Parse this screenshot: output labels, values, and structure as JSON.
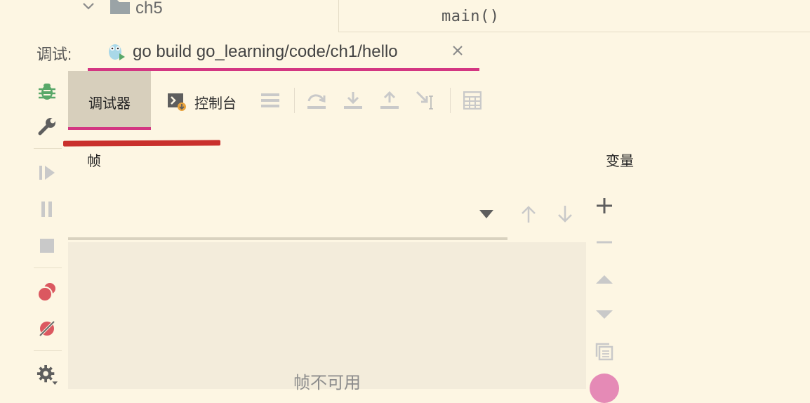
{
  "project_tree": {
    "folder_label": "ch5"
  },
  "editor": {
    "breadcrumb_function": "main()"
  },
  "debug_window": {
    "label": "调试:",
    "run_config_tab": {
      "title": "go build go_learning/code/ch1/hello"
    }
  },
  "toolbar": {
    "tabs": [
      {
        "label": "调试器",
        "selected": true
      },
      {
        "label": "控制台",
        "selected": false
      }
    ],
    "icons": [
      "menu-icon",
      "step-over-icon",
      "step-into-icon",
      "step-out-icon",
      "run-to-cursor-icon",
      "evaluate-icon"
    ]
  },
  "frames": {
    "header": "帧",
    "empty_text": "帧不可用"
  },
  "variables": {
    "header": "变量"
  },
  "left_strip": {
    "icons": [
      "debug-bug-icon",
      "wrench-icon",
      "resume-icon",
      "pause-icon",
      "stop-icon",
      "view-breakpoints-icon",
      "mute-breakpoints-icon",
      "settings-icon"
    ]
  },
  "colors": {
    "background": "#fdf6e3",
    "accent_underline": "#d33682",
    "annotation_red": "#c9302c",
    "selected_tab_bg": "#d7cfbc"
  }
}
